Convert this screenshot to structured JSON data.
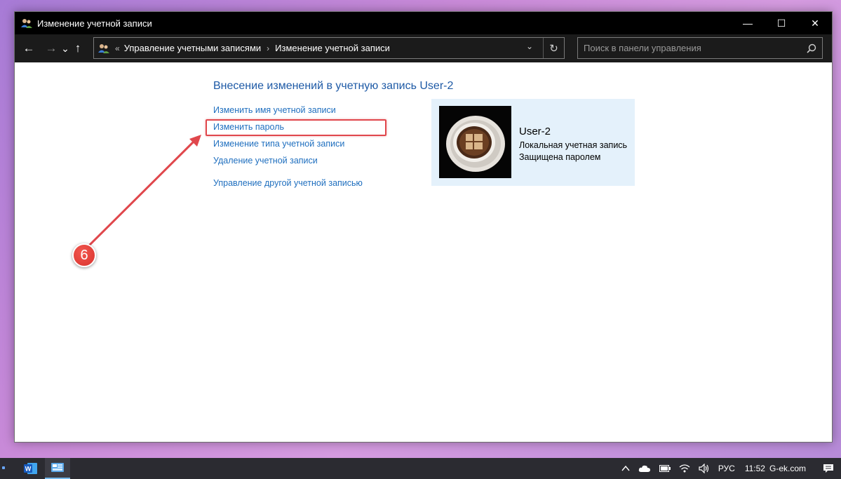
{
  "window": {
    "title": "Изменение учетной записи",
    "controls": {
      "minimize": "—",
      "maximize": "☐",
      "close": "✕"
    }
  },
  "addressbar": {
    "back_icon": "←",
    "forward_icon": "→",
    "recent_icon": "⌄",
    "up_icon": "↑",
    "path_sep": "«",
    "breadcrumb": [
      "Управление учетными записями",
      "Изменение учетной записи"
    ],
    "crumb_sep": "›",
    "dropdown_icon": "⌄",
    "refresh_icon": "↻",
    "search_placeholder": "Поиск в панели управления"
  },
  "main": {
    "heading": "Внесение изменений в учетную запись User-2",
    "links": [
      "Изменить имя учетной записи",
      "Изменить пароль",
      "Изменение типа учетной записи",
      "Удаление учетной записи",
      "Управление другой учетной записью"
    ],
    "highlighted_link_index": 1
  },
  "user_card": {
    "name": "User-2",
    "account_type": "Локальная учетная запись",
    "status": "Защищена паролем"
  },
  "annotation": {
    "step": "6",
    "color": "#e0474c"
  },
  "taskbar": {
    "apps": [
      "word-icon",
      "control-panel-icon"
    ],
    "language": "РУС",
    "time": "11:52",
    "site": "G-ek.com"
  },
  "colors": {
    "link": "#1f6fbf",
    "heading": "#1e5aa6",
    "card_bg": "#e4f1fb",
    "titlebar": "#000000"
  }
}
